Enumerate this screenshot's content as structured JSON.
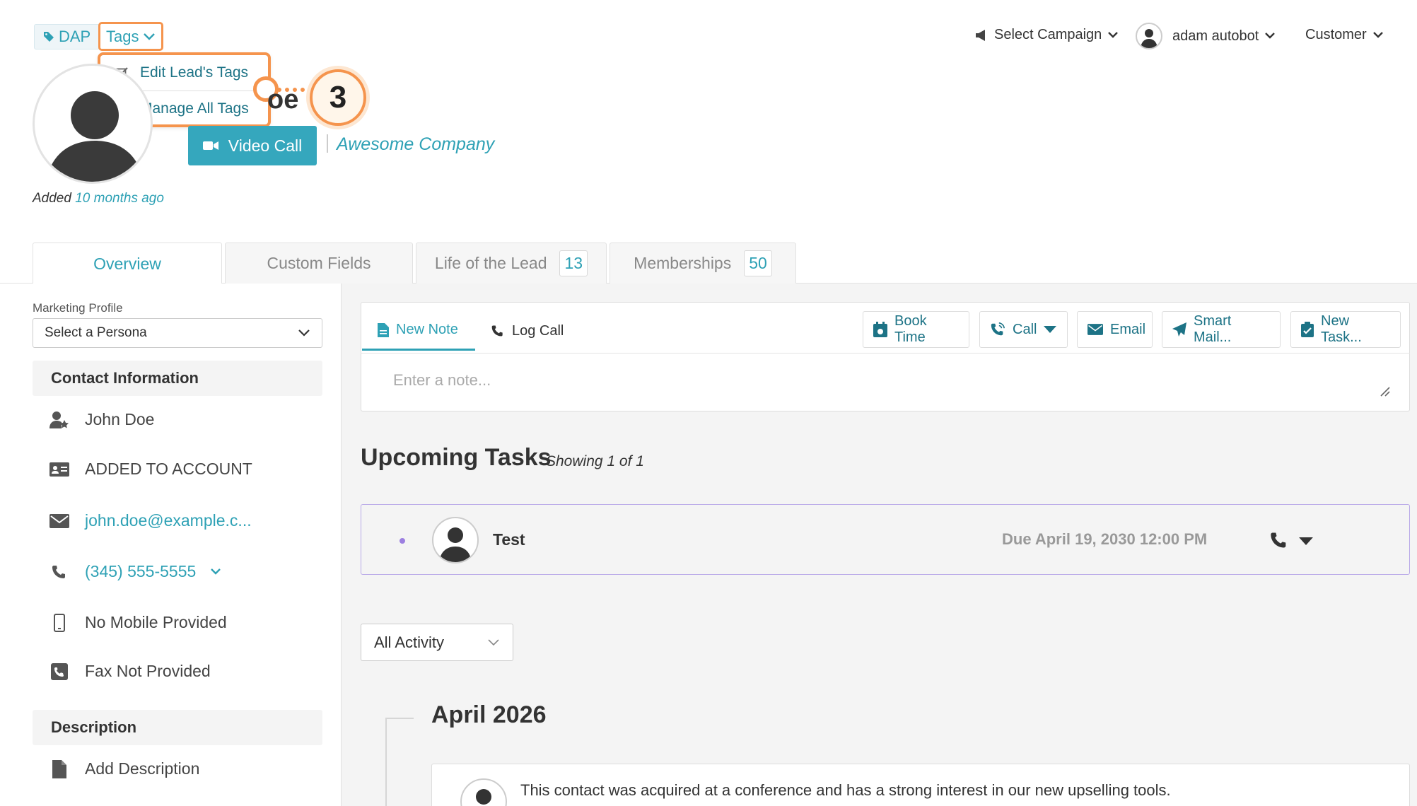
{
  "header": {
    "tag_chip": "DAP",
    "tags_dropdown": "Tags",
    "tags_menu": [
      {
        "label": "Edit Lead's Tags",
        "icon": "edit-icon"
      },
      {
        "label": "Manage All Tags",
        "icon": "gear-icon"
      }
    ],
    "step_number": "3",
    "select_campaign": "Select Campaign",
    "user_name": "adam autobot",
    "role": "Customer"
  },
  "lead": {
    "name_fragment": "oe",
    "video_call": "Video Call",
    "company": "Awesome Company",
    "added_prefix": "Added",
    "added_when": "10 months ago"
  },
  "tabs": [
    {
      "label": "Overview",
      "count": null
    },
    {
      "label": "Custom Fields",
      "count": null
    },
    {
      "label": "Life of the Lead",
      "count": "13"
    },
    {
      "label": "Memberships",
      "count": "50"
    }
  ],
  "sidebar": {
    "marketing_label": "Marketing Profile",
    "persona_value": "Select a Persona",
    "contact_heading": "Contact Information",
    "contact_name": "John Doe",
    "account_status": "ADDED TO ACCOUNT",
    "email": "john.doe@example.c...",
    "phone": "(345) 555-5555",
    "mobile": "No Mobile Provided",
    "fax": "Fax Not Provided",
    "description_heading": "Description",
    "add_description": "Add Description"
  },
  "composer": {
    "tab_new_note": "New Note",
    "tab_log_call": "Log Call",
    "book_time": "Book Time",
    "call": "Call",
    "email": "Email",
    "smart_mail": "Smart Mail...",
    "new_task": "New Task...",
    "placeholder": "Enter a note..."
  },
  "tasks": {
    "title": "Upcoming Tasks",
    "showing": "Showing 1 of 1",
    "items": [
      {
        "name": "Test",
        "due": "Due April 19, 2030 12:00 PM"
      }
    ]
  },
  "activity": {
    "filter": "All Activity",
    "month": "April 2026",
    "entry_text": "This contact was acquired at a conference and has a strong interest in our new upselling tools."
  },
  "colors": {
    "accent": "#2ea1b5",
    "highlight": "#f5944d",
    "task_border": "#b9a9e8"
  }
}
